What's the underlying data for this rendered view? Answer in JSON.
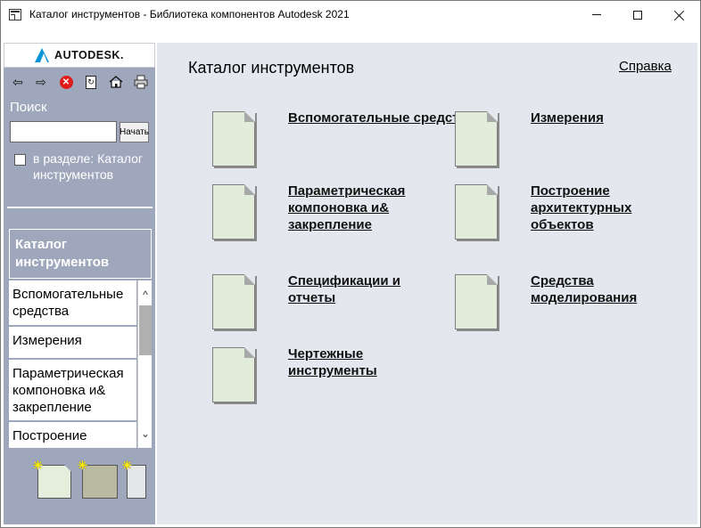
{
  "window": {
    "title": "Каталог инструментов - Библиотека компонентов Autodesk 2021"
  },
  "sidebar": {
    "logo_text": "AUTODESK.",
    "toolbar": {
      "back_icon": "arrow-left-icon",
      "forward_icon": "arrow-right-icon",
      "stop_icon": "stop-icon",
      "refresh_icon": "refresh-icon",
      "home_icon": "home-icon",
      "print_icon": "print-icon"
    },
    "search_label": "Поиск",
    "search_value": "",
    "search_button": "Начать",
    "scope_label": "в разделе: Каталог инструментов",
    "toc_header": "Каталог инструментов",
    "toc_items": [
      "Вспомогательные средства",
      "Измерения",
      "Параметрическая компоновка и& закрепление",
      "Построение"
    ]
  },
  "main": {
    "title": "Каталог инструментов",
    "help_link": "Справка",
    "categories": [
      "Вспомогательные средства",
      "Измерения",
      "Параметрическая компоновка и& закрепление",
      "Построение архитектурных объектов",
      "Спецификации и отчеты",
      "Средства моделирования",
      "Чертежные инструменты"
    ]
  },
  "colors": {
    "sidebar_bg": "#9ea7bb",
    "main_bg": "#e4e8ee",
    "doc_fill": "#e1ecda",
    "stop_red": "#e01a1a",
    "logo_blue": "#0696d7"
  }
}
